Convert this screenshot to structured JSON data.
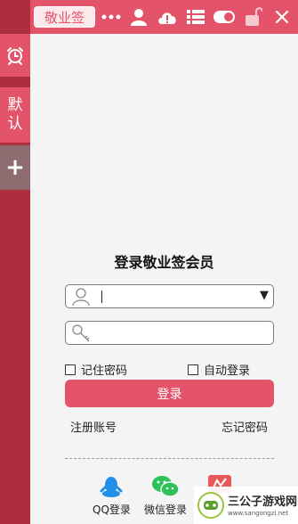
{
  "toolbar": {
    "brand_label": "敬业签",
    "icons": [
      "more-icon",
      "user-icon",
      "cloud-warning-icon",
      "list-icon",
      "toggle-icon",
      "unlock-icon"
    ]
  },
  "sidebar": {
    "default_label_line1": "默",
    "default_label_line2": "认",
    "add_label": "+"
  },
  "login": {
    "title": "登录敬业签会员",
    "username_value": "",
    "password_value": "",
    "remember_label": "记住密码",
    "auto_login_label": "自动登录",
    "login_button": "登录",
    "register_link": "注册账号",
    "forgot_link": "忘记密码"
  },
  "social": {
    "qq_label": "QQ登录",
    "wechat_label": "微信登录",
    "weibo_label": ""
  },
  "watermark": {
    "title": "三公子游戏网",
    "url": "www.sangongzi.net"
  },
  "colors": {
    "accent": "#e3546a",
    "sidebar": "#ad2e3d",
    "add_button": "#8d6b6f",
    "qq": "#1f8fea",
    "wechat": "#2ec15a"
  }
}
